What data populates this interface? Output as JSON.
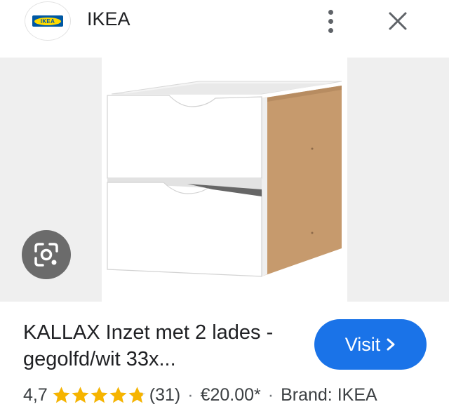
{
  "header": {
    "logo_text": "IKEA",
    "site_name": "IKEA"
  },
  "colors": {
    "accent": "#1a73e8",
    "star": "#f6b400",
    "ikea_blue": "#0058a3",
    "ikea_yellow": "#ffdb00"
  },
  "product": {
    "title": "KALLAX Inzet met 2 lades - gegolfd/wit 33x...",
    "rating": "4,7",
    "rating_value": 4.7,
    "rating_max": 5,
    "review_count": "(31)",
    "price": "€20.00*",
    "brand": "Brand: IKEA"
  },
  "actions": {
    "visit_label": "Visit"
  },
  "icons": {
    "more": "more-vert-icon",
    "close": "close-icon",
    "lens": "google-lens-icon",
    "visit_chevron": "chevron-right-icon"
  }
}
